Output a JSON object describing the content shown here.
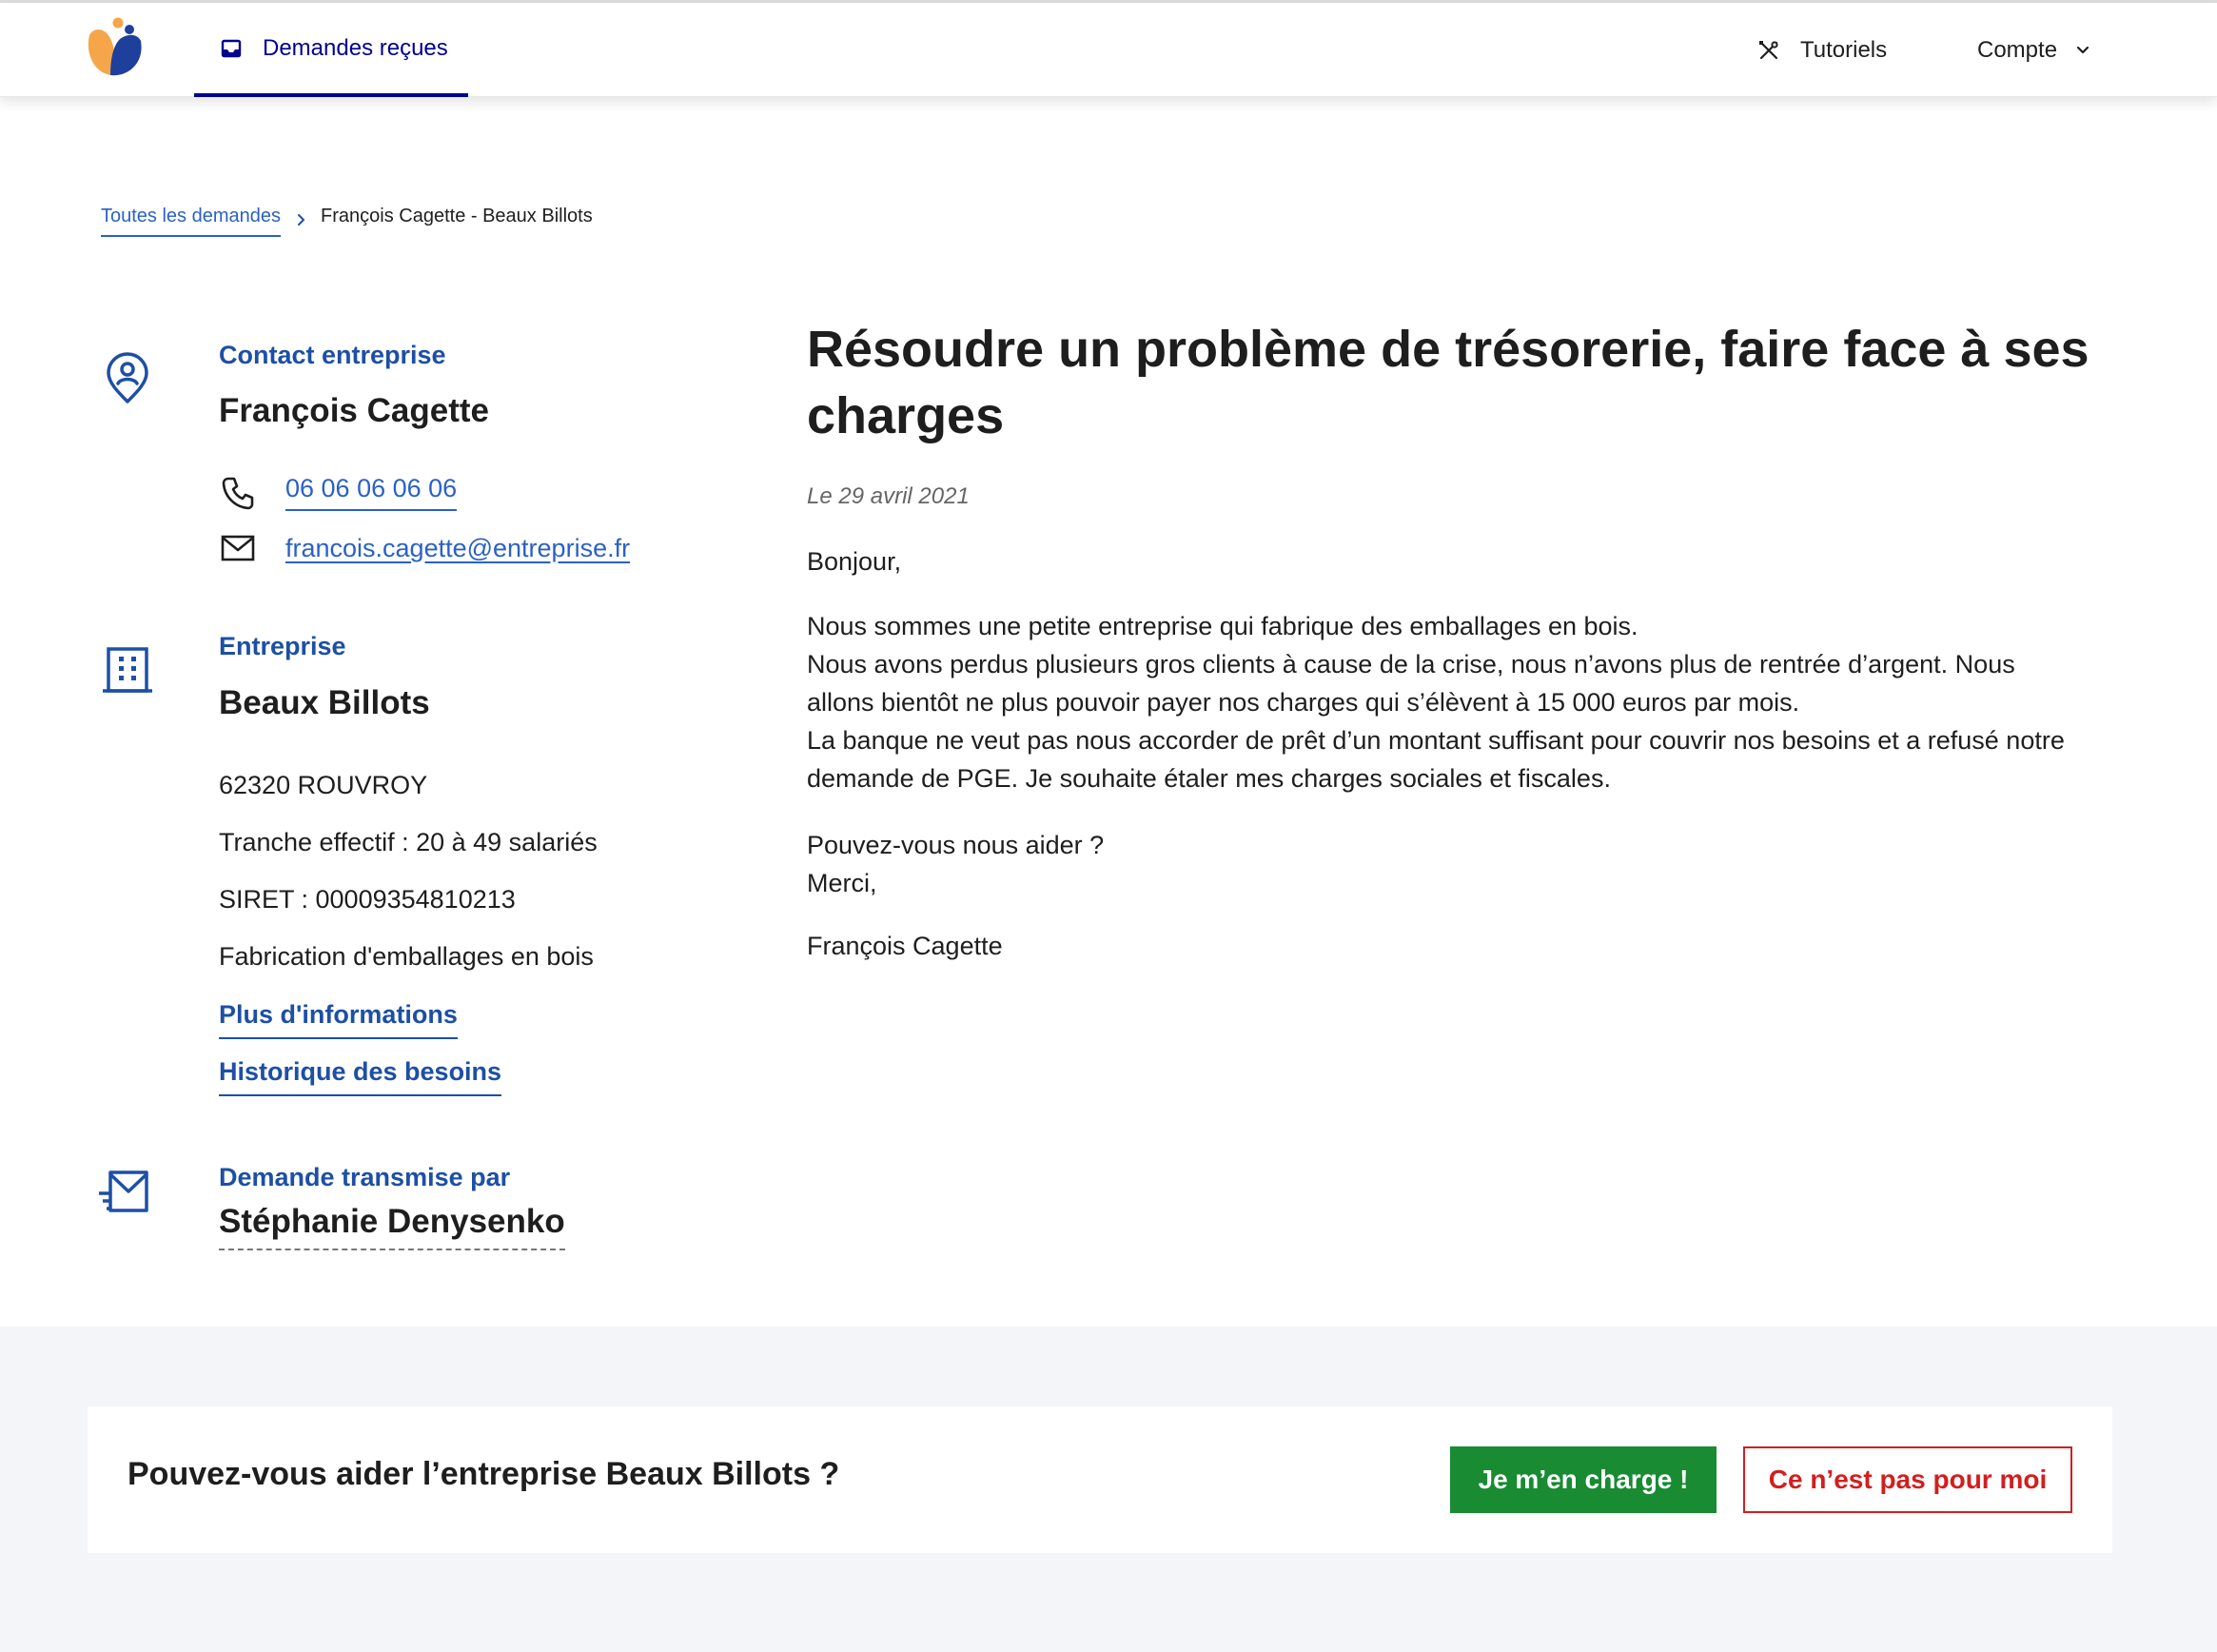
{
  "header": {
    "logo_icon": "place-des-entreprises-logo",
    "nav_active": {
      "label": "Demandes reçues",
      "icon": "inbox-icon"
    },
    "tutoriels": {
      "label": "Tutoriels",
      "icon": "tools-icon"
    },
    "compte": {
      "label": "Compte",
      "icon": "chevron-down-icon"
    }
  },
  "breadcrumb": {
    "parent": "Toutes les demandes",
    "current": "François Cagette - Beaux Billots"
  },
  "contact": {
    "section_label": "Contact entreprise",
    "name": "François Cagette",
    "phone": "06 06 06 06 06",
    "email": "francois.cagette@entreprise.fr"
  },
  "entreprise": {
    "section_label": "Entreprise",
    "name": "Beaux Billots",
    "address": "62320 ROUVROY",
    "tranche": "Tranche effectif : 20 à 49 salariés",
    "siret": "SIRET : 00009354810213",
    "activite": "Fabrication d'emballages en bois",
    "more_info_link": "Plus d'informations",
    "history_link": "Historique des besoins"
  },
  "transmission": {
    "section_label": "Demande transmise par",
    "name": "Stéphanie Denysenko"
  },
  "demande": {
    "title": "Résoudre un problème de trésorerie, faire face à ses charges",
    "date": "Le 29 avril 2021",
    "greeting": "Bonjour,",
    "body_lines": [
      "Nous sommes une petite entreprise qui fabrique des emballages en bois.",
      "Nous avons perdus plusieurs gros clients à cause de la crise, nous n’avons plus de rentrée d’argent. Nous allons bientôt ne plus pouvoir payer nos charges qui s’élèvent à 15 000 euros par mois.",
      "La banque ne veut pas nous accorder de prêt d’un montant suffisant pour couvrir nos besoins et a refusé notre demande de PGE. Je souhaite étaler mes charges sociales et fiscales."
    ],
    "question": "Pouvez-vous nous aider ?",
    "thanks": "Merci,",
    "signature": "François Cagette"
  },
  "cta": {
    "question": "Pouvez-vous aider l’entreprise Beaux Billots ?",
    "accept_label": "Je m’en charge !",
    "decline_label": "Ce n’est pas pour moi",
    "accept_color": "#188b33",
    "decline_color": "#d31e1e"
  }
}
